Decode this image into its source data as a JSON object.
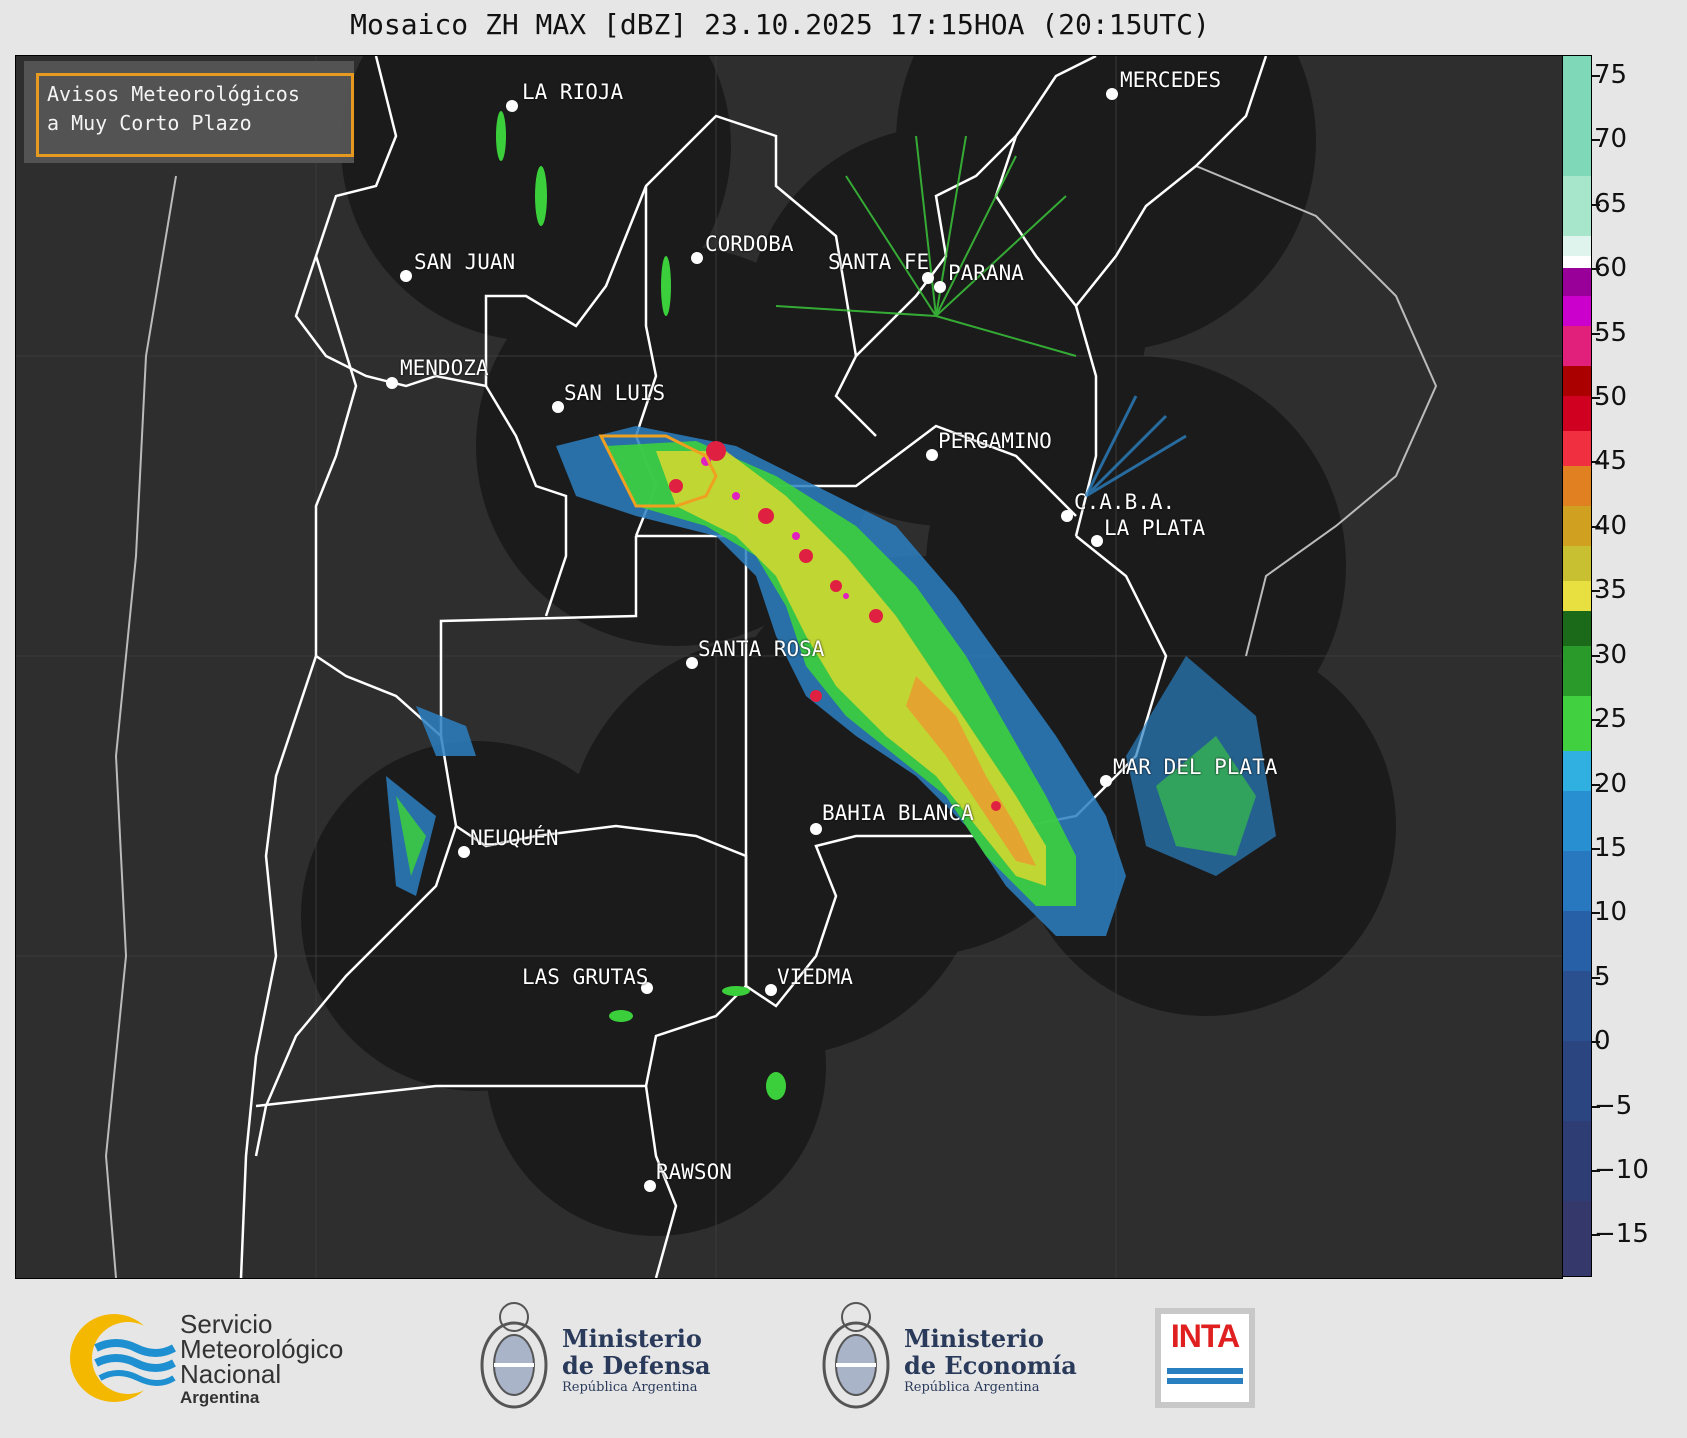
{
  "title": "Mosaico ZH MAX [dBZ] 23.10.2025 17:15HOA (20:15UTC)",
  "legend": {
    "line1": "Avisos Meteorológicos",
    "line2": "a Muy Corto Plazo",
    "border_color": "#f0a020"
  },
  "colorbar": {
    "ticks": [
      "75",
      "70",
      "65",
      "60",
      "55",
      "50",
      "45",
      "40",
      "35",
      "30",
      "25",
      "20",
      "15",
      "10",
      "5",
      "0",
      "−5",
      "−10",
      "−15"
    ]
  },
  "cities": [
    {
      "name": "LA RIOJA"
    },
    {
      "name": "MERCEDES"
    },
    {
      "name": "SAN JUAN"
    },
    {
      "name": "CORDOBA"
    },
    {
      "name": "SANTA FE"
    },
    {
      "name": "PARANA"
    },
    {
      "name": "MENDOZA"
    },
    {
      "name": "SAN LUIS"
    },
    {
      "name": "PERGAMINO"
    },
    {
      "name": "C.A.B.A."
    },
    {
      "name": "LA PLATA"
    },
    {
      "name": "SANTA ROSA"
    },
    {
      "name": "MAR DEL PLATA"
    },
    {
      "name": "BAHIA BLANCA"
    },
    {
      "name": "NEUQUÉN"
    },
    {
      "name": "LAS GRUTAS"
    },
    {
      "name": "VIEDMA"
    },
    {
      "name": "RAWSON"
    }
  ],
  "footer": {
    "smn": {
      "line1": "Servicio",
      "line2": "Meteorológico",
      "line3": "Nacional",
      "line4": "Argentina"
    },
    "defensa": {
      "line1": "Ministerio",
      "line2": "de Defensa",
      "line3": "República Argentina"
    },
    "economia": {
      "line1": "Ministerio",
      "line2": "de Economía",
      "line3": "República Argentina"
    },
    "inta": {
      "label": "INTA"
    }
  }
}
